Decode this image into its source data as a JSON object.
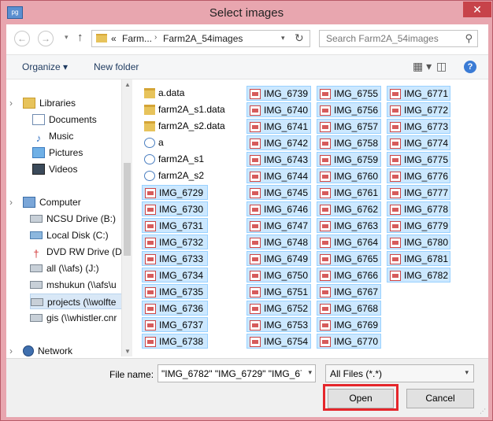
{
  "window": {
    "title": "Select images",
    "app_icon_label": "pg",
    "close_glyph": "✕"
  },
  "navbar": {
    "back_glyph": "←",
    "forward_glyph": "→",
    "dropdown_glyph": "▾",
    "up_glyph": "↑",
    "breadcrumb": [
      "«",
      "Farm...",
      "Farm2A_54images"
    ],
    "breadcrumb_sep": "›",
    "refresh_glyph": "↻",
    "search_placeholder": "Search Farm2A_54images",
    "search_glyph": "⚲"
  },
  "toolbar": {
    "organize": "Organize ▾",
    "new_folder": "New folder",
    "view_glyph": "▦ ▾",
    "pane_glyph": "◫",
    "help_glyph": "?"
  },
  "navpane": {
    "libraries": "Libraries",
    "documents": "Documents",
    "music": "Music",
    "pictures": "Pictures",
    "videos": "Videos",
    "computer": "Computer",
    "drives": [
      "NCSU Drive (B:)",
      "Local Disk (C:)",
      "DVD RW Drive (D:",
      "all (\\\\afs) (J:)",
      "mshukun (\\\\afs\\u",
      "projects (\\\\wolfte",
      "gis (\\\\whistler.cnr"
    ],
    "network": "Network",
    "expand_glyph": "›",
    "scroll_up": "▲",
    "scroll_down": "▼"
  },
  "files": {
    "col1": [
      "a.data",
      "farm2A_s1.data",
      "farm2A_s2.data",
      "a",
      "farm2A_s1",
      "farm2A_s2",
      "IMG_6729",
      "IMG_6730",
      "IMG_6731",
      "IMG_6732",
      "IMG_6733",
      "IMG_6734",
      "IMG_6735",
      "IMG_6736",
      "IMG_6737",
      "IMG_6738"
    ],
    "col2": [
      "IMG_6739",
      "IMG_6740",
      "IMG_6741",
      "IMG_6742",
      "IMG_6743",
      "IMG_6744",
      "IMG_6745",
      "IMG_6746",
      "IMG_6747",
      "IMG_6748",
      "IMG_6749",
      "IMG_6750",
      "IMG_6751",
      "IMG_6752",
      "IMG_6753",
      "IMG_6754"
    ],
    "col3": [
      "IMG_6755",
      "IMG_6756",
      "IMG_6757",
      "IMG_6758",
      "IMG_6759",
      "IMG_6760",
      "IMG_6761",
      "IMG_6762",
      "IMG_6763",
      "IMG_6764",
      "IMG_6765",
      "IMG_6766",
      "IMG_6767",
      "IMG_6768",
      "IMG_6769",
      "IMG_6770"
    ],
    "col4": [
      "IMG_6771",
      "IMG_6772",
      "IMG_6773",
      "IMG_6774",
      "IMG_6775",
      "IMG_6776",
      "IMG_6777",
      "IMG_6778",
      "IMG_6779",
      "IMG_6780",
      "IMG_6781",
      "IMG_6782"
    ]
  },
  "bottom": {
    "file_name_label": "File name:",
    "file_name_value": "\"IMG_6782\" \"IMG_6729\" \"IMG_673",
    "filter_value": "All Files (*.*)",
    "dropdown_glyph": "▾",
    "open_label": "Open",
    "cancel_label": "Cancel",
    "grip_glyph": "⋰"
  },
  "colors": {
    "frame": "#e8a6af",
    "selection": "#cce8ff",
    "selection_border": "#99d1ff",
    "highlight_box": "#e5262b"
  }
}
